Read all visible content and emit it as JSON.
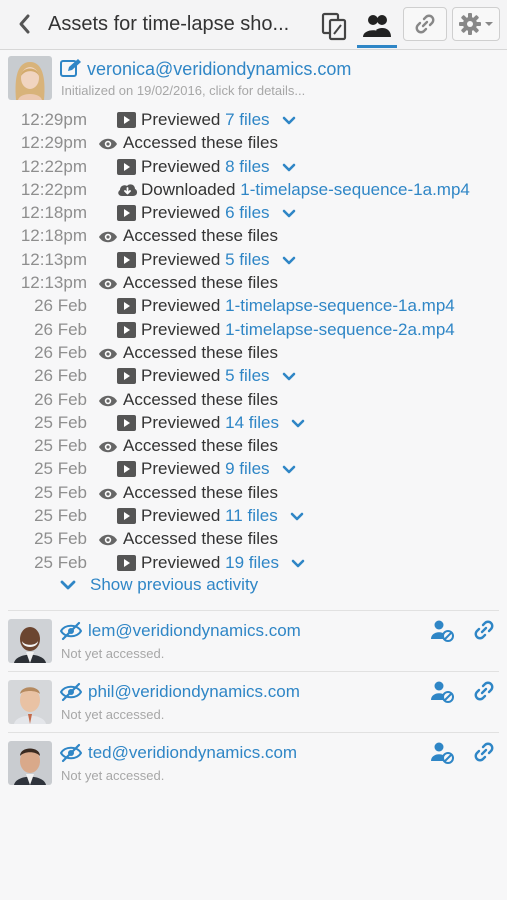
{
  "header": {
    "title": "Assets for time-lapse sho...",
    "back_icon": "chevron-left-icon"
  },
  "owner": {
    "email": "veronica@veridiondynamics.com",
    "subtitle": "Initialized on 19/02/2016, click for details..."
  },
  "activity": [
    {
      "time": "12:29pm",
      "type": "preview",
      "verb": "Previewed",
      "target": "7 files",
      "expandable": true
    },
    {
      "time": "12:29pm",
      "type": "access",
      "verb": "Accessed these files"
    },
    {
      "time": "12:22pm",
      "type": "preview",
      "verb": "Previewed",
      "target": "8 files",
      "expandable": true
    },
    {
      "time": "12:22pm",
      "type": "download",
      "verb": "Downloaded",
      "target": "1-timelapse-sequence-1a.mp4",
      "expandable": false
    },
    {
      "time": "12:18pm",
      "type": "preview",
      "verb": "Previewed",
      "target": "6 files",
      "expandable": true
    },
    {
      "time": "12:18pm",
      "type": "access",
      "verb": "Accessed these files"
    },
    {
      "time": "12:13pm",
      "type": "preview",
      "verb": "Previewed",
      "target": "5 files",
      "expandable": true
    },
    {
      "time": "12:13pm",
      "type": "access",
      "verb": "Accessed these files"
    },
    {
      "time": "26 Feb",
      "type": "preview",
      "verb": "Previewed",
      "target": "1-timelapse-sequence-1a.mp4",
      "expandable": false
    },
    {
      "time": "26 Feb",
      "type": "preview",
      "verb": "Previewed",
      "target": "1-timelapse-sequence-2a.mp4",
      "expandable": false
    },
    {
      "time": "26 Feb",
      "type": "access",
      "verb": "Accessed these files"
    },
    {
      "time": "26 Feb",
      "type": "preview",
      "verb": "Previewed",
      "target": "5 files",
      "expandable": true
    },
    {
      "time": "26 Feb",
      "type": "access",
      "verb": "Accessed these files"
    },
    {
      "time": "25 Feb",
      "type": "preview",
      "verb": "Previewed",
      "target": "14 files",
      "expandable": true
    },
    {
      "time": "25 Feb",
      "type": "access",
      "verb": "Accessed these files"
    },
    {
      "time": "25 Feb",
      "type": "preview",
      "verb": "Previewed",
      "target": "9 files",
      "expandable": true
    },
    {
      "time": "25 Feb",
      "type": "access",
      "verb": "Accessed these files"
    },
    {
      "time": "25 Feb",
      "type": "preview",
      "verb": "Previewed",
      "target": "11 files",
      "expandable": true
    },
    {
      "time": "25 Feb",
      "type": "access",
      "verb": "Accessed these files"
    },
    {
      "time": "25 Feb",
      "type": "preview",
      "verb": "Previewed",
      "target": "19 files",
      "expandable": true
    }
  ],
  "show_previous": "Show previous activity",
  "invitees": [
    {
      "email": "lem@veridiondynamics.com",
      "status": "Not yet accessed."
    },
    {
      "email": "phil@veridiondynamics.com",
      "status": "Not yet accessed."
    },
    {
      "email": "ted@veridiondynamics.com",
      "status": "Not yet accessed."
    }
  ],
  "colors": {
    "accent": "#2f86c6",
    "muted": "#a7a7a7",
    "text": "#333333"
  }
}
